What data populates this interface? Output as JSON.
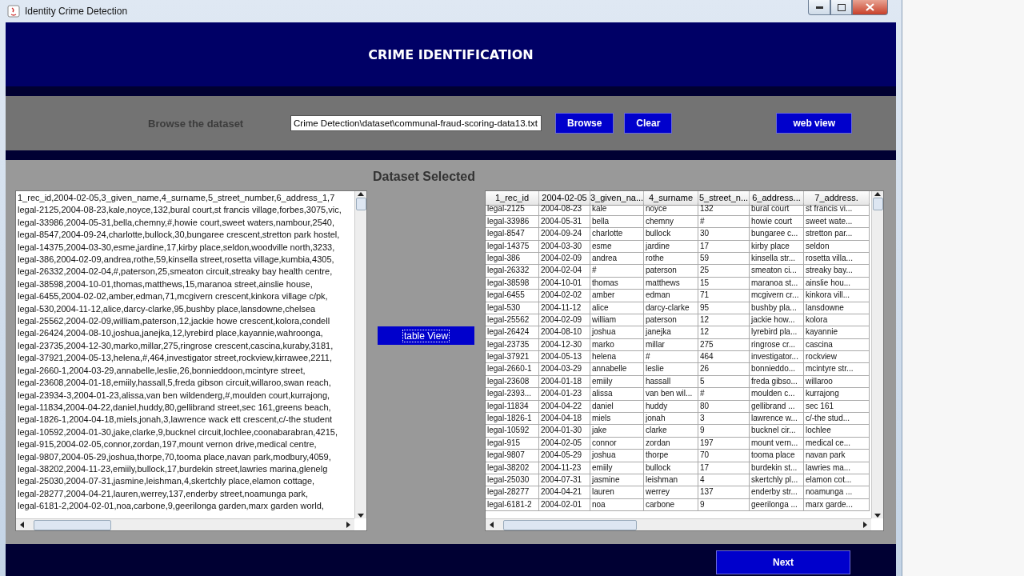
{
  "window": {
    "title": "Identity Crime Detection"
  },
  "header": {
    "title": "CRIME IDENTIFICATION"
  },
  "browse_bar": {
    "label": "Browse the dataset",
    "path": {
      "value": "Crime Detection\\dataset\\communal-fraud-scoring-data13.txt"
    },
    "buttons": [
      "Browse",
      "Clear"
    ],
    "web_view_button": "web view"
  },
  "dataset_panel": {
    "title": "Dataset  Selected",
    "text_area": {
      "lines": [
        "1_rec_id,2004-02-05,3_given_name,4_surname,5_street_number,6_address_1,7",
        "legal-2125,2004-08-23,kale,noyce,132,bural court,st francis village,forbes,3075,vic,",
        "legal-33986,2004-05-31,bella,chemny,#,howie court,sweet waters,nambour,2540,",
        "legal-8547,2004-09-24,charlotte,bullock,30,bungaree crescent,stretton park hostel,",
        "legal-14375,2004-03-30,esme,jardine,17,kirby place,seldon,woodville north,3233,",
        "legal-386,2004-02-09,andrea,rothe,59,kinsella street,rosetta village,kumbia,4305,",
        "legal-26332,2004-02-04,#,paterson,25,smeaton circuit,streaky bay health centre,",
        "legal-38598,2004-10-01,thomas,matthews,15,maranoa street,ainslie house,",
        "legal-6455,2004-02-02,amber,edman,71,mcgivern crescent,kinkora village c/pk,",
        "legal-530,2004-11-12,alice,darcy-clarke,95,bushby place,lansdowne,chelsea",
        "legal-25562,2004-02-09,william,paterson,12,jackie howe crescent,kolora,condell",
        "legal-26424,2004-08-10,joshua,janejka,12,lyrebird place,kayannie,wahroonga,",
        "legal-23735,2004-12-30,marko,millar,275,ringrose crescent,cascina,kuraby,3181,",
        "legal-37921,2004-05-13,helena,#,464,investigator street,rockview,kirrawee,2211,",
        "legal-2660-1,2004-03-29,annabelle,leslie,26,bonnieddoon,mcintyre street,",
        "legal-23608,2004-01-18,emiily,hassall,5,freda gibson circuit,willaroo,swan reach,",
        "legal-23934-3,2004-01-23,alissa,van ben wildenderg,#,moulden court,kurrajong,",
        "legal-11834,2004-04-22,daniel,huddy,80,gellibrand street,sec 161,greens beach,",
        "legal-1826-1,2004-04-18,miels,jonah,3,lawrence wack ett crescent,c/-the student",
        "legal-10592,2004-01-30,jake,clarke,9,bucknel circuit,lochlee,coonabarabran,4215,",
        "legal-915,2004-02-05,connor,zordan,197,mount vernon drive,medical centre,",
        "legal-9807,2004-05-29,joshua,thorpe,70,tooma place,navan park,modbury,4059,",
        "legal-38202,2004-11-23,emiily,bullock,17,burdekin street,lawries marina,glenelg",
        "legal-25030,2004-07-31,jasmine,leishman,4,skertchly place,elamon cottage,",
        "legal-28277,2004-04-21,lauren,werrey,137,enderby street,noamunga park,",
        "legal-6181-2,2004-02-01,noa,carbone,9,geerilonga garden,marx garden world,"
      ]
    },
    "table_view_button": "table View",
    "table": {
      "columns": [
        "1_rec_id",
        "2004-02-05",
        "3_given_na...",
        "4_surname",
        "5_street_n...",
        "6_address...",
        "7_address."
      ],
      "rows": [
        [
          "legal-2125",
          "2004-08-23",
          "kale",
          "noyce",
          "132",
          "bural court",
          "st francis vi..."
        ],
        [
          "legal-33986",
          "2004-05-31",
          "bella",
          "chemny",
          "#",
          "howie court",
          "sweet wate..."
        ],
        [
          "legal-8547",
          "2004-09-24",
          "charlotte",
          "bullock",
          "30",
          "bungaree c...",
          "stretton par..."
        ],
        [
          "legal-14375",
          "2004-03-30",
          "esme",
          "jardine",
          "17",
          "kirby place",
          "seldon"
        ],
        [
          "legal-386",
          "2004-02-09",
          "andrea",
          "rothe",
          "59",
          "kinsella str...",
          "rosetta villa..."
        ],
        [
          "legal-26332",
          "2004-02-04",
          "#",
          "paterson",
          "25",
          "smeaton ci...",
          "streaky bay..."
        ],
        [
          "legal-38598",
          "2004-10-01",
          "thomas",
          "matthews",
          "15",
          "maranoa st...",
          "ainslie hou..."
        ],
        [
          "legal-6455",
          "2004-02-02",
          "amber",
          "edman",
          "71",
          "mcgivern cr...",
          "kinkora vill..."
        ],
        [
          "legal-530",
          "2004-11-12",
          "alice",
          "darcy-clarke",
          "95",
          "bushby pla...",
          "lansdowne"
        ],
        [
          "legal-25562",
          "2004-02-09",
          "william",
          "paterson",
          "12",
          "jackie how...",
          "kolora"
        ],
        [
          "legal-26424",
          "2004-08-10",
          "joshua",
          "janejka",
          "12",
          "lyrebird pla...",
          "kayannie"
        ],
        [
          "legal-23735",
          "2004-12-30",
          "marko",
          "millar",
          "275",
          "ringrose cr...",
          "cascina"
        ],
        [
          "legal-37921",
          "2004-05-13",
          "helena",
          "#",
          "464",
          "investigator...",
          "rockview"
        ],
        [
          "legal-2660-1",
          "2004-03-29",
          "annabelle",
          "leslie",
          "26",
          "bonnieddo...",
          "mcintyre str..."
        ],
        [
          "legal-23608",
          "2004-01-18",
          "emiily",
          "hassall",
          "5",
          "freda gibso...",
          "willaroo"
        ],
        [
          "legal-2393...",
          "2004-01-23",
          "alissa",
          "van ben wil...",
          "#",
          "moulden c...",
          "kurrajong"
        ],
        [
          "legal-11834",
          "2004-04-22",
          "daniel",
          "huddy",
          "80",
          "gellibrand ...",
          "sec 161"
        ],
        [
          "legal-1826-1",
          "2004-04-18",
          "miels",
          "jonah",
          "3",
          "lawrence w...",
          "c/-the stud..."
        ],
        [
          "legal-10592",
          "2004-01-30",
          "jake",
          "clarke",
          "9",
          "bucknel cir...",
          "lochlee"
        ],
        [
          "legal-915",
          "2004-02-05",
          "connor",
          "zordan",
          "197",
          "mount vern...",
          "medical ce..."
        ],
        [
          "legal-9807",
          "2004-05-29",
          "joshua",
          "thorpe",
          "70",
          "tooma place",
          "navan park"
        ],
        [
          "legal-38202",
          "2004-11-23",
          "emiily",
          "bullock",
          "17",
          "burdekin st...",
          "lawries ma..."
        ],
        [
          "legal-25030",
          "2004-07-31",
          "jasmine",
          "leishman",
          "4",
          "skertchly pl...",
          "elamon cot..."
        ],
        [
          "legal-28277",
          "2004-04-21",
          "lauren",
          "werrey",
          "137",
          "enderby str...",
          "noamunga ..."
        ],
        [
          "legal-6181-2",
          "2004-02-01",
          "noa",
          "carbone",
          "9",
          "geerilonga ...",
          "marx garde..."
        ]
      ]
    }
  },
  "next_button": "Next"
}
